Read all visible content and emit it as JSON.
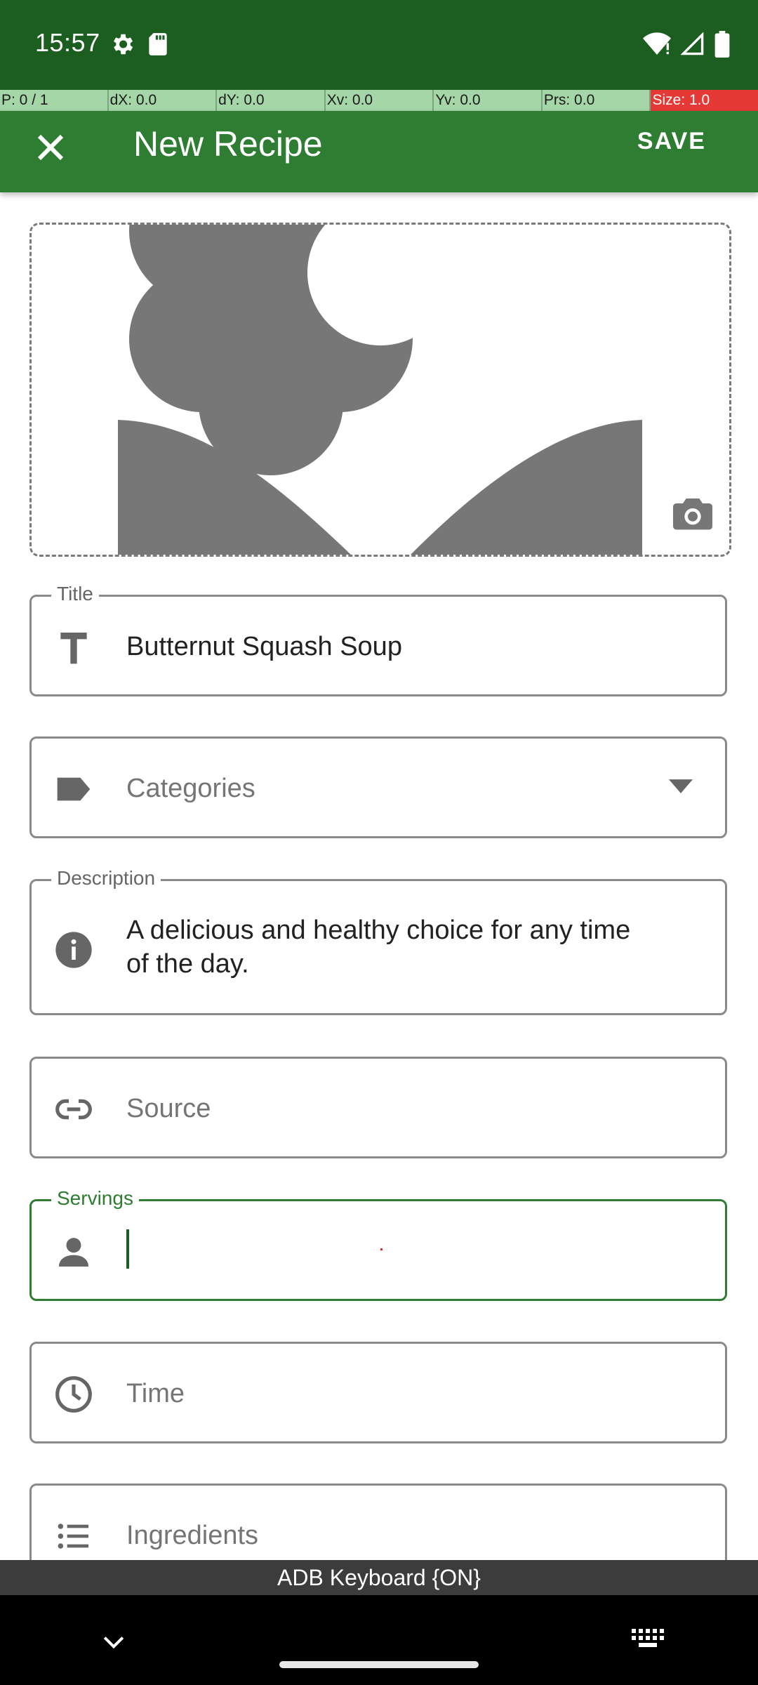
{
  "status_bar": {
    "time": "15:57",
    "icons": [
      "settings-gear-icon",
      "sd-card-icon",
      "wifi-icon",
      "cell-signal-icon",
      "battery-icon"
    ]
  },
  "debug": {
    "cells": [
      "P: 0 / 1",
      "dX: 0.0",
      "dY: 0.0",
      "Xv: 0.0",
      "Yv: 0.0",
      "Prs: 0.0",
      "Size: 1.0"
    ]
  },
  "appbar": {
    "title": "New Recipe",
    "save_label": "SAVE",
    "background": "#2e7d32"
  },
  "image_placeholder": {
    "icon": "flower-placeholder-icon",
    "camera_icon": "camera-icon"
  },
  "fields": {
    "title": {
      "legend": "Title",
      "value": "Butternut Squash Soup",
      "icon": "text-T-icon"
    },
    "categories": {
      "placeholder": "Categories",
      "icon": "label-tag-icon"
    },
    "description": {
      "legend": "Description",
      "value_line1": "A delicious and healthy choice for any time",
      "value_line2": "of the day.",
      "icon": "info-icon"
    },
    "source": {
      "placeholder": "Source",
      "icon": "link-icon"
    },
    "servings": {
      "legend": "Servings",
      "value": "",
      "icon": "person-icon"
    },
    "time": {
      "placeholder": "Time",
      "icon": "clock-icon"
    },
    "ingredients": {
      "placeholder": "Ingredients",
      "icon": "list-icon"
    }
  },
  "keyboard": {
    "label": "ADB Keyboard {ON}"
  },
  "colors": {
    "focus": "#2e7d32",
    "status_bar": "#1b5e20",
    "debug_cell": "#a5d6a7",
    "debug_last": "#e53935"
  }
}
